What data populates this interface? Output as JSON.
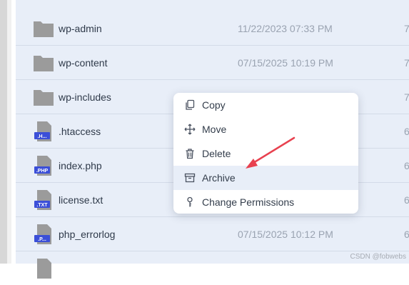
{
  "files": [
    {
      "name": "wp-admin",
      "date": "11/22/2023 07:33 PM",
      "extra": "7",
      "icon": "folder-icon"
    },
    {
      "name": "wp-content",
      "date": "07/15/2025 10:19 PM",
      "extra": "7",
      "icon": "folder-icon"
    },
    {
      "name": "wp-includes",
      "date": "",
      "extra": "7",
      "icon": "folder-icon"
    },
    {
      "name": ".htaccess",
      "date": "",
      "extra": "6",
      "icon": "file-icon",
      "ext": ".H..."
    },
    {
      "name": "index.php",
      "date": "",
      "extra": "6",
      "icon": "file-icon",
      "ext": ".PHP"
    },
    {
      "name": "license.txt",
      "date": "",
      "extra": "6",
      "icon": "file-icon",
      "ext": ".TXT"
    },
    {
      "name": "php_errorlog",
      "date": "07/15/2025 10:12 PM",
      "extra": "6",
      "icon": "file-icon",
      "ext": ".P..."
    }
  ],
  "context_menu": {
    "items": [
      {
        "label": "Copy",
        "icon": "copy-icon"
      },
      {
        "label": "Move",
        "icon": "move-icon"
      },
      {
        "label": "Delete",
        "icon": "trash-icon"
      },
      {
        "label": "Archive",
        "icon": "archive-icon"
      },
      {
        "label": "Change Permissions",
        "icon": "key-icon"
      }
    ],
    "highlighted": "Archive"
  },
  "annotation_arrow_color": "#e8414f",
  "watermark": "CSDN @fobwebs"
}
